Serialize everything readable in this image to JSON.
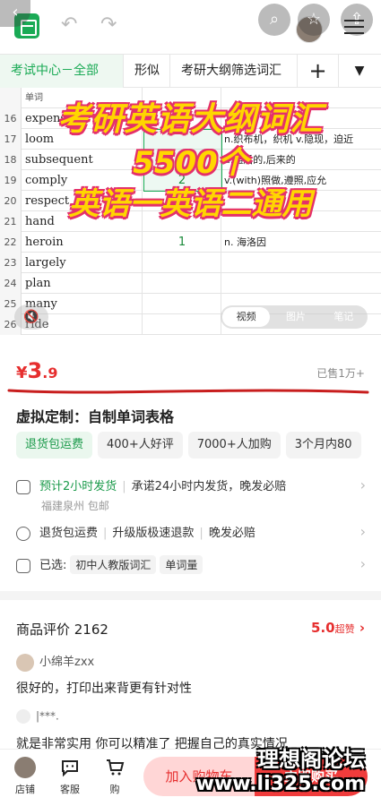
{
  "toolbar": {
    "back": "‹",
    "search": "⌕",
    "fav": "☆",
    "share": "⇪",
    "undo": "↶",
    "redo": "↷"
  },
  "tabs": {
    "active": "考试中心－全部",
    "t2": "形似",
    "t3": "考研大纲筛选词汇",
    "add": "+",
    "more": "▼"
  },
  "sheet": {
    "header_label": "单词",
    "rows": [
      {
        "n": "16",
        "word": "expensive",
        "count": "",
        "def": ""
      },
      {
        "n": "17",
        "word": "loom",
        "count": "",
        "def": "n.织布机，织机 v.隐现，迫近"
      },
      {
        "n": "18",
        "word": "subsequent",
        "count": "",
        "def": "a.随后的,后来的"
      },
      {
        "n": "19",
        "word": "comply",
        "count": "2",
        "def": "v.(with)照做,遵照,应允"
      },
      {
        "n": "20",
        "word": "respect",
        "count": "",
        "def": ""
      },
      {
        "n": "21",
        "word": "hand",
        "count": "",
        "def": ""
      },
      {
        "n": "22",
        "word": "heroin",
        "count": "1",
        "def": "n. 海洛因"
      },
      {
        "n": "23",
        "word": "largely",
        "count": "",
        "def": ""
      },
      {
        "n": "24",
        "word": "plan",
        "count": "",
        "def": ""
      },
      {
        "n": "25",
        "word": "many",
        "count": "",
        "def": ""
      },
      {
        "n": "26",
        "word": "ride",
        "count": "",
        "def": ""
      }
    ]
  },
  "overlay": {
    "line1": "考研英语大纲词汇",
    "line2": "5500个",
    "line3": "英语一英语二通用"
  },
  "media": {
    "video": "视频",
    "image": "图片",
    "note": "笔记",
    "mute": "🔇"
  },
  "price": {
    "currency": "¥",
    "int": "3",
    "dec": ".9",
    "sold": "已售1万+"
  },
  "product": {
    "title": "虚拟定制：自制单词表格"
  },
  "chips": [
    "退货包运费",
    "400+人好评",
    "7000+人加购",
    "3个月内80"
  ],
  "shipping": {
    "eta": "预计2小时发货",
    "promise": "承诺24小时内发货，晚发必赔",
    "origin": "福建泉州 包邮"
  },
  "service": {
    "a": "退货包运费",
    "b": "升级版极速退款",
    "c": "晚发必赔"
  },
  "selected": {
    "label": "已选:",
    "opt1": "初中人教版词汇",
    "opt2": "单词量"
  },
  "reviews": {
    "title": "商品评价 2162",
    "score": "5.0",
    "score_tag": "超赞",
    "user1": "小绵羊zxx",
    "text1": "很好的，打印出来背更有针对性",
    "user2": "|***.",
    "text2": "就是非常实用 你可以精准了 把握自己的真实情况"
  },
  "bottom": {
    "shop": "店铺",
    "service": "客服",
    "cart_icon": "购",
    "cart": "加入购物车",
    "buy": "立即购买"
  },
  "watermark": {
    "line1": "理想阁论坛",
    "line2": "www.li325.com"
  },
  "colors": {
    "brand_green": "#1aaa55",
    "price_red": "#e62e2e",
    "overlay_yellow": "#ffd600"
  }
}
